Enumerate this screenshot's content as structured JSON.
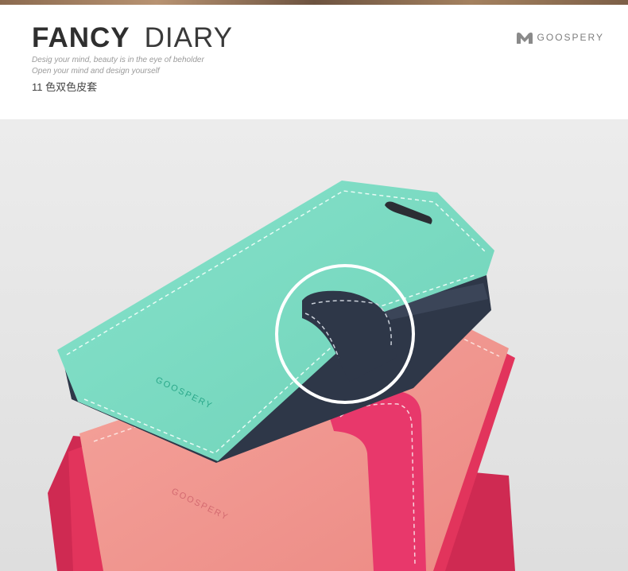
{
  "header": {
    "title_bold": "FANCY",
    "title_light": "DIARY",
    "tagline_1": "Desig your mind, beauty is in the eye of beholder",
    "tagline_2": "Open your mind and design yourself",
    "subtitle": "11 色双色皮套"
  },
  "brand": {
    "name": "GOOSPERY",
    "logo_icon": "mercury-m-logo-icon",
    "logo_color": "#8a8a8a"
  },
  "product_photo": {
    "case_top_label": "GOOSPERY",
    "case_bottom_label": "GOOSPERY",
    "colors": {
      "mint": "#7fdcc4",
      "navy": "#2e3748",
      "pink": "#f09088",
      "magenta": "#e2345c",
      "background": "#e6e6e6",
      "highlight_ring": "#ffffff"
    }
  }
}
